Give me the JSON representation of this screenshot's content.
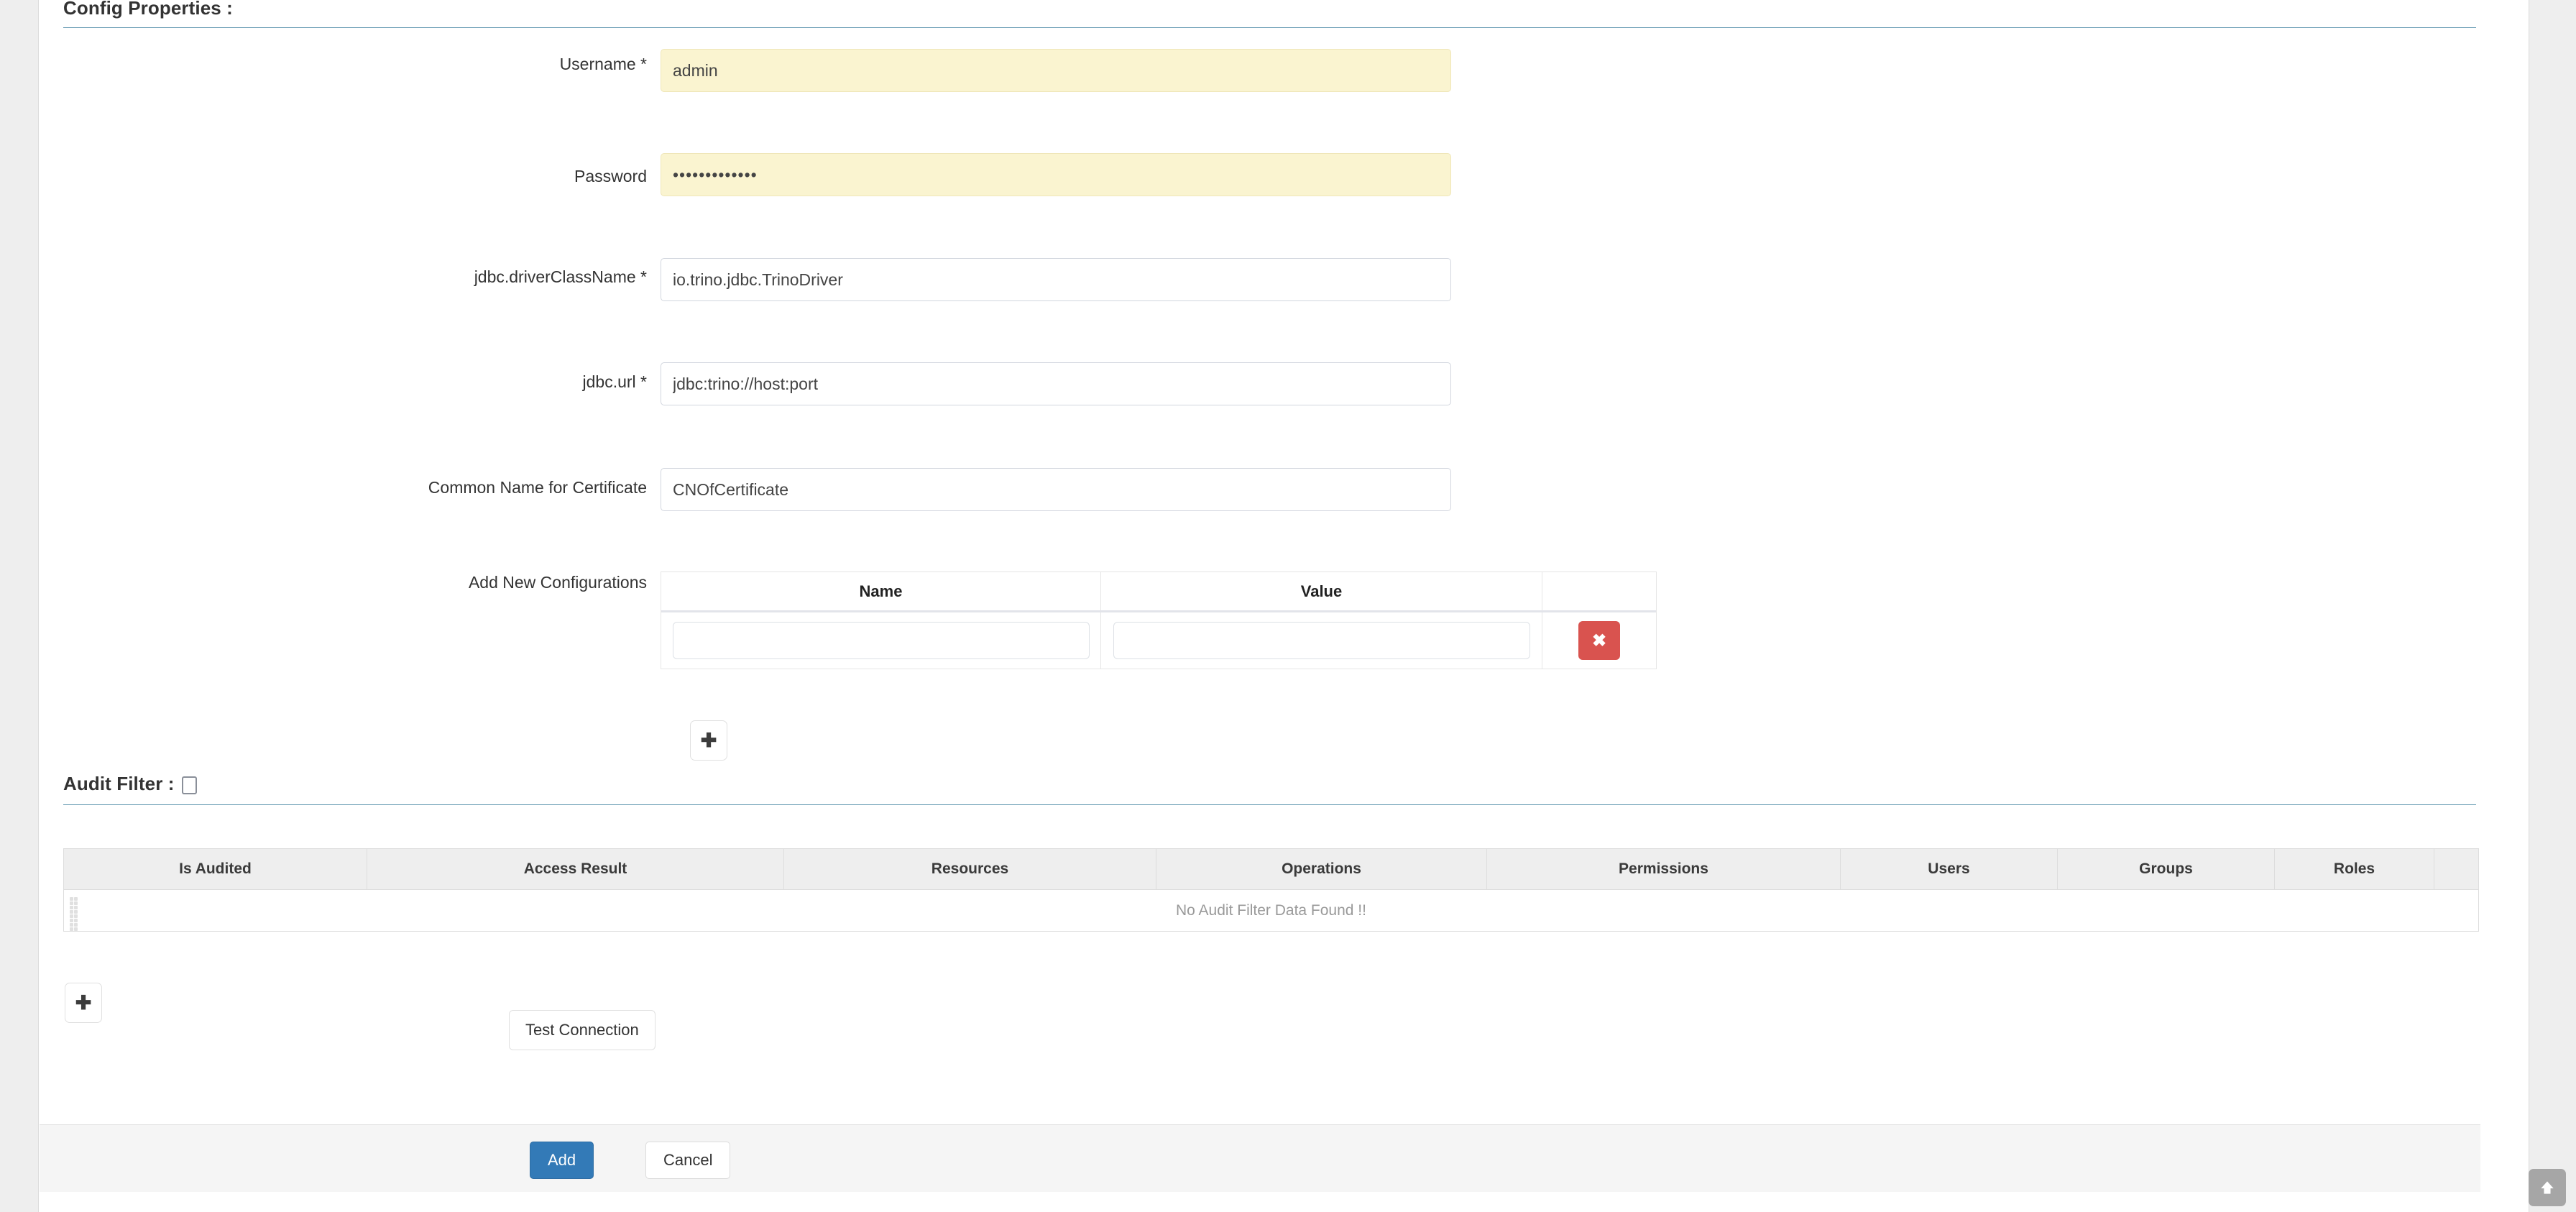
{
  "sections": {
    "config_properties_title": "Config Properties :",
    "audit_filter_title": "Audit Filter :"
  },
  "form": {
    "fields": [
      {
        "label": "Username *",
        "value": "admin",
        "placeholder": "",
        "autofilled": true
      },
      {
        "label": "Password",
        "value": "•••••••••••••",
        "placeholder": "",
        "autofilled": true
      },
      {
        "label": "jdbc.driverClassName *",
        "value": "io.trino.jdbc.TrinoDriver",
        "placeholder": "",
        "autofilled": false
      },
      {
        "label": "jdbc.url *",
        "value": "jdbc:trino://host:port",
        "placeholder": "",
        "autofilled": false
      },
      {
        "label": "Common Name for Certificate",
        "value": "CNOfCertificate",
        "placeholder": "",
        "autofilled": false
      }
    ],
    "add_new_configurations_label": "Add New Configurations"
  },
  "config_table": {
    "columns": [
      "Name",
      "Value"
    ],
    "rows": [
      {
        "name": "",
        "value": "",
        "name_placeholder": "",
        "value_placeholder": ""
      }
    ],
    "delete_label": "✖",
    "add_row_label": "✚"
  },
  "audit_table": {
    "columns": [
      "Is Audited",
      "Access Result",
      "Resources",
      "Operations",
      "Permissions",
      "Users",
      "Groups",
      "Roles"
    ],
    "empty_message": "No Audit Filter Data Found !!",
    "add_row_label": "✚"
  },
  "buttons": {
    "test_connection": "Test Connection",
    "add": "Add",
    "cancel": "Cancel",
    "scroll_top_icon": "arrow-up-icon"
  },
  "colors": {
    "accent_blue": "#337ab7",
    "rule_blue": "#5b93ad",
    "danger_red": "#d9534f",
    "autofill_yellow": "#faf4d0",
    "header_gray": "#eeeeee"
  }
}
